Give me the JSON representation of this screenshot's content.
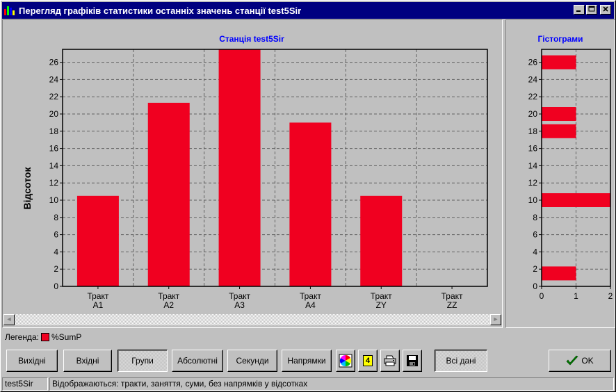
{
  "window": {
    "title": "Перегляд графіків статистики останніх значень станції test5Sir"
  },
  "main_chart_title": "Станція test5Sir",
  "side_chart_title": "Гістограми",
  "ylabel": "Відсоток",
  "legend": {
    "label": "Легенда:",
    "series_name": "%SumP"
  },
  "toolbar": {
    "outgoing": "Вихідні",
    "incoming": "Вхідні",
    "groups": "Групи",
    "absolute": "Абсолютні",
    "seconds": "Секунди",
    "directions": "Напрямки",
    "color_icon": "palette-icon",
    "number_badge": "4",
    "print_icon": "printer-icon",
    "save_icon": "floppy-disk-icon",
    "all_data": "Всі дані",
    "ok": "OK"
  },
  "status": {
    "station": "test5Sir",
    "message": "Відображаються: тракти, заняття, суми, без напрямків у відсотках"
  },
  "colors": {
    "bar": "#f00020",
    "title_blue": "#0000ff",
    "titlebar": "#000080"
  },
  "chart_data": [
    {
      "type": "bar",
      "title": "Станція test5Sir",
      "ylabel": "Відсоток",
      "categories": [
        [
          "Тракт",
          "A1"
        ],
        [
          "Тракт",
          "A2"
        ],
        [
          "Тракт",
          "A3"
        ],
        [
          "Тракт",
          "A4"
        ],
        [
          "Тракт",
          "ZY"
        ],
        [
          "Тракт",
          "ZZ"
        ]
      ],
      "series": [
        {
          "name": "%SumP",
          "values": [
            10.5,
            21.3,
            27.5,
            19.0,
            10.5,
            0
          ]
        }
      ],
      "yticks": [
        0,
        2,
        4,
        6,
        8,
        10,
        12,
        14,
        16,
        18,
        20,
        22,
        24,
        26
      ],
      "ylim": [
        0,
        27.5
      ],
      "grid": true
    },
    {
      "type": "bar",
      "orientation": "horizontal",
      "title": "Гістограми",
      "bins": [
        {
          "y": 26,
          "count": 1
        },
        {
          "y": 20,
          "count": 1
        },
        {
          "y": 18,
          "count": 1
        },
        {
          "y": 10,
          "count": 2
        },
        {
          "y": 1.5,
          "count": 1
        }
      ],
      "yticks": [
        0,
        2,
        4,
        6,
        8,
        10,
        12,
        14,
        16,
        18,
        20,
        22,
        24,
        26
      ],
      "xticks": [
        0,
        1,
        2
      ],
      "ylim": [
        0,
        27.5
      ],
      "xlim": [
        0,
        2
      ],
      "grid": true
    }
  ]
}
